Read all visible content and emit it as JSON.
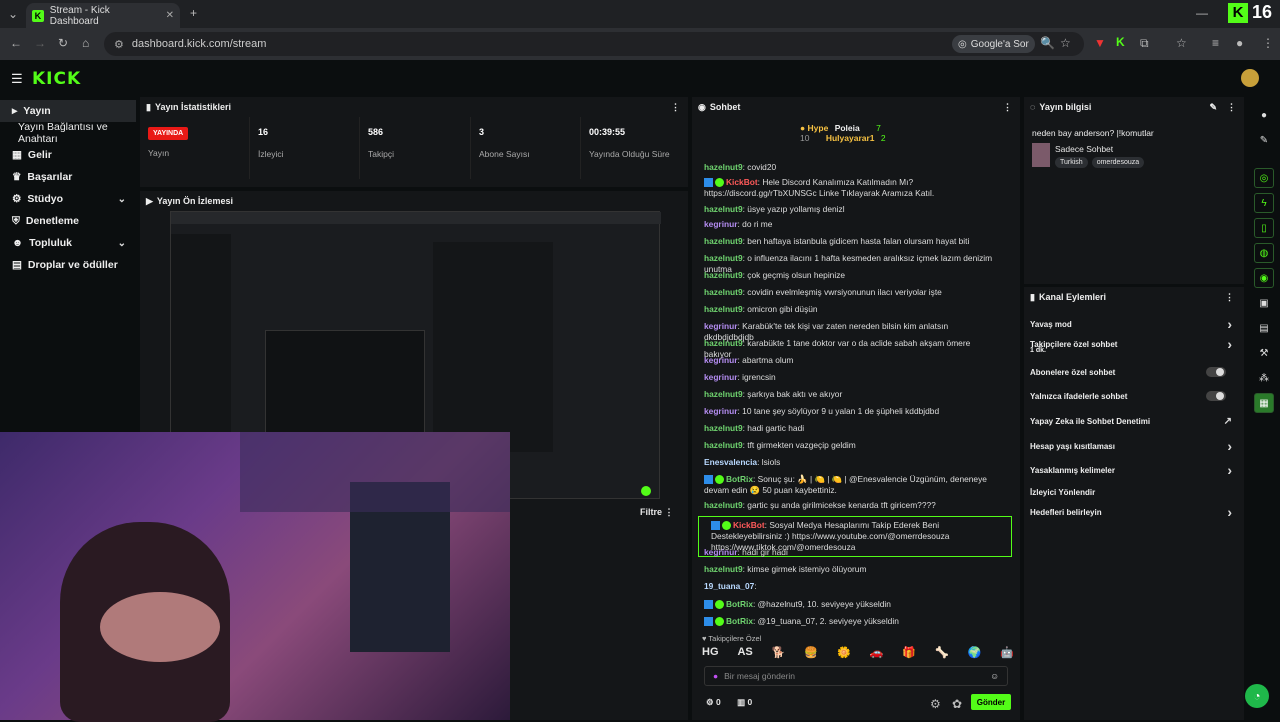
{
  "browser": {
    "tab_title": "Stream - Kick Dashboard",
    "url": "dashboard.kick.com/stream",
    "google_ask": "Google'a Sor",
    "overlay_count": "16"
  },
  "app": {
    "logo": "KICK"
  },
  "sidebar": {
    "items": [
      {
        "label": "Yayın",
        "icon": "broadcast"
      },
      {
        "label": "Yayın Bağlantısı ve Anahtarı",
        "icon": ""
      },
      {
        "label": "Gelir",
        "icon": "grid-icon"
      },
      {
        "label": "Başarılar",
        "icon": "trophy-icon"
      },
      {
        "label": "Stüdyo",
        "icon": "studio-icon"
      },
      {
        "label": "Denetleme",
        "icon": "shield-icon"
      },
      {
        "label": "Topluluk",
        "icon": "people-icon"
      },
      {
        "label": "Droplar ve ödüller",
        "icon": "gift-icon"
      }
    ]
  },
  "stats": {
    "title": "Yayın İstatistikleri",
    "live_badge": "YAYINDA",
    "live_label": "Yayın",
    "items": [
      {
        "value": "16",
        "label": "İzleyici"
      },
      {
        "value": "586",
        "label": "Takipçi"
      },
      {
        "value": "3",
        "label": "Abone Sayısı"
      },
      {
        "value": "00:39:55",
        "label": "Yayında Olduğu Süre"
      }
    ]
  },
  "preview": {
    "title": "Yayın Ön İzlemesi",
    "filter": "Filtre"
  },
  "chat": {
    "title": "Sohbet",
    "hype": "Hype",
    "hype_n": "10",
    "top1": "Poleia",
    "top1_n": "7",
    "top2": "Hulyayarar1",
    "top2_n": "2",
    "lines": [
      {
        "user": "hazelnut9",
        "text": "covid20",
        "cls": "g",
        "bot": false
      },
      {
        "user": "KickBot",
        "text": "Hele Discord Kanalımıza Katılmadın Mı? https://discord.gg/rTbXUNSGc Linke Tıklayarak Aramıza Katıl.",
        "cls": "r",
        "bot": true
      },
      {
        "user": "hazelnut9",
        "text": "üsye yazıp yollamış denizl",
        "cls": "g",
        "bot": false
      },
      {
        "user": "kegrinur",
        "text": "do ri me",
        "cls": "p",
        "bot": false
      },
      {
        "user": "hazelnut9",
        "text": "ben haftaya istanbula gidicem hasta falan olursam hayat biti",
        "cls": "g",
        "bot": false
      },
      {
        "user": "hazelnut9",
        "text": "o influenza ilacını 1 hafta kesmeden aralıksız içmek lazım denizim unutma",
        "cls": "g",
        "bot": false
      },
      {
        "user": "hazelnut9",
        "text": "çok geçmiş olsun hepinize",
        "cls": "g",
        "bot": false
      },
      {
        "user": "hazelnut9",
        "text": "covidin evelmleşmiş vwrsiyonunun ilacı veriyolar işte",
        "cls": "g",
        "bot": false
      },
      {
        "user": "hazelnut9",
        "text": "omicron gibi düşün",
        "cls": "g",
        "bot": false
      },
      {
        "user": "kegrinur",
        "text": "Karabük'te tek kişi var zaten nereden bilsin kim anlatsın dkdbdjdbdjdb",
        "cls": "p",
        "bot": false
      },
      {
        "user": "hazelnut9",
        "text": "karabükte 1 tane doktor var o da aclide sabah akşam ömere bakıyor",
        "cls": "g",
        "bot": false
      },
      {
        "user": "kegrinur",
        "text": "abartma olum",
        "cls": "p",
        "bot": false
      },
      {
        "user": "kegrinur",
        "text": "igrencsin",
        "cls": "p",
        "bot": false
      },
      {
        "user": "hazelnut9",
        "text": "şarkıya bak aktı ve akıyor",
        "cls": "g",
        "bot": false
      },
      {
        "user": "kegrinur",
        "text": "10 tane şey söylüyor 9 u yalan 1 de şüpheli kddbjdbd",
        "cls": "p",
        "bot": false
      },
      {
        "user": "hazelnut9",
        "text": "hadi gartic hadi",
        "cls": "g",
        "bot": false
      },
      {
        "user": "hazelnut9",
        "text": "tft girmekten vazgeçip geldim",
        "cls": "g",
        "bot": false
      },
      {
        "user": "Enesvalencia",
        "text": "lsiols",
        "cls": "gl",
        "bot": false
      },
      {
        "user": "BotRix",
        "text": "Sonuç şu: 🍌 | 🍋 | 🍋 | @Enesvalencie Üzgünüm, deneneye devam edin 😢 50 puan kaybettiniz.",
        "cls": "g",
        "bot": true
      },
      {
        "user": "hazelnut9",
        "text": "gartic şu anda girilmicekse kenarda tft giricem????",
        "cls": "g",
        "bot": false
      },
      {
        "user": "KickBot",
        "text": "Sosyal Medya Hesaplarımı Takip Ederek Beni Destekleyebilirsiniz :) https://www.youtube.com/@omerrdesouza https://www.tiktok.com/@omerdesouza",
        "cls": "r",
        "bot": true
      },
      {
        "user": "kegrinur",
        "text": "hadi gir hadi",
        "cls": "p",
        "bot": false
      },
      {
        "user": "hazelnut9",
        "text": "kimse girmek istemiyo ölüyorum",
        "cls": "g",
        "bot": false
      },
      {
        "user": "19_tuana_07",
        "text": "",
        "cls": "gl",
        "bot": false
      },
      {
        "user": "BotRix",
        "text": "@hazelnut9, 10. seviyeye yükseldin",
        "cls": "g",
        "bot": true
      },
      {
        "user": "BotRix",
        "text": "@19_tuana_07, 2. seviyeye yükseldin",
        "cls": "g",
        "bot": true
      }
    ],
    "followers_only": "Takipçilere Özel",
    "emotes": [
      "HG",
      "AS",
      "🐕",
      "🍔",
      "🌼",
      "🚗",
      "🎁",
      "🦴",
      "🌍",
      "🤖"
    ],
    "input_placeholder": "Bir mesaj gönderin",
    "send": "Gönder",
    "points": "0",
    "count": "0"
  },
  "stream_info": {
    "title": "Yayın bilgisi",
    "stream_title": "neden bay anderson? |!komutlar",
    "tags_label": "Sadece Sohbet",
    "tags": [
      "Turkish",
      "omerdesouza"
    ]
  },
  "channel_actions": {
    "title": "Kanal Eylemleri",
    "items": [
      {
        "label": "Yavaş mod",
        "sub": "",
        "control": "chevron"
      },
      {
        "label": "Takipçilere özel sohbet",
        "sub": "1 dk.",
        "control": "chevron"
      },
      {
        "label": "Abonelere özel sohbet",
        "sub": "",
        "control": "toggle"
      },
      {
        "label": "Yalnızca ifadelerle sohbet",
        "sub": "",
        "control": "toggle"
      },
      {
        "label": "Yapay Zeka ile Sohbet Denetimi",
        "sub": "",
        "control": "external"
      },
      {
        "label": "Hesap yaşı kısıtlaması",
        "sub": "",
        "control": "chevron"
      },
      {
        "label": "Yasaklanmış kelimeler",
        "sub": "",
        "control": "chevron"
      },
      {
        "label": "İzleyici Yönlendir",
        "sub": "",
        "control": ""
      },
      {
        "label": "Hedefleri belirleyin",
        "sub": "",
        "control": "chevron"
      }
    ]
  },
  "colors": {
    "brand": "#53fc18",
    "live": "#e91916"
  }
}
